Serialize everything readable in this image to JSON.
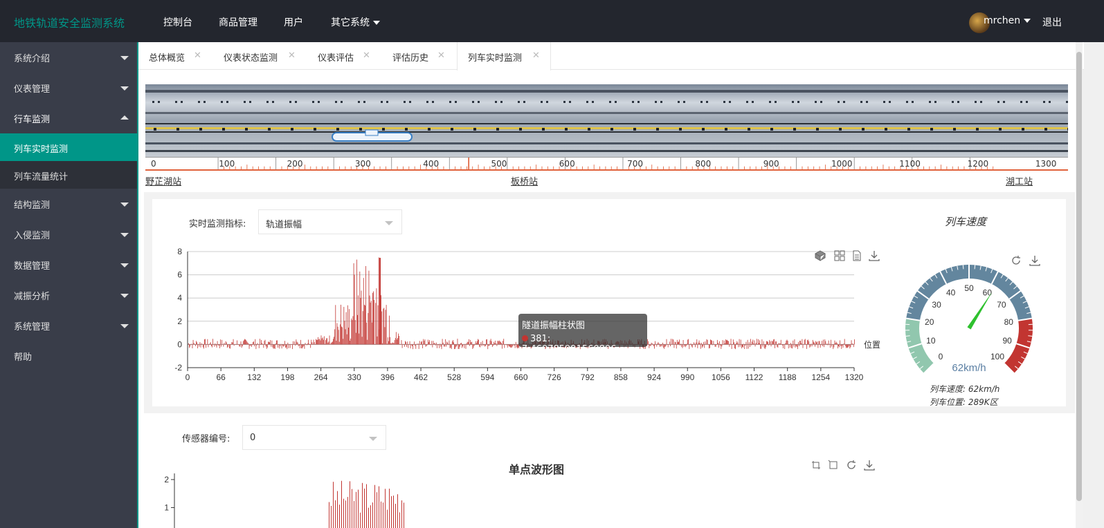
{
  "app": {
    "title": "地铁轨道安全监测系统"
  },
  "topnav": {
    "items": [
      "控制台",
      "商品管理",
      "用户",
      "其它系统"
    ],
    "user": "mrchen",
    "logout": "退出"
  },
  "sidebar": {
    "items": [
      {
        "label": "系统介绍"
      },
      {
        "label": "仪表管理"
      },
      {
        "label": "行车监测"
      },
      {
        "label": "结构监测"
      },
      {
        "label": "入侵监测"
      },
      {
        "label": "数据管理"
      },
      {
        "label": "减振分析"
      },
      {
        "label": "系统管理"
      },
      {
        "label": "帮助"
      }
    ],
    "sub": [
      "列车实时监测",
      "列车流量统计"
    ]
  },
  "tabs": [
    "总体概览",
    "仪表状态监测",
    "仪表评估",
    "评估历史",
    "列车实时监测"
  ],
  "track": {
    "ruler_labels": [
      "0",
      "100",
      "200",
      "300",
      "400",
      "500",
      "600",
      "700",
      "800",
      "900",
      "1000",
      "1100",
      "1200",
      "1300"
    ],
    "stations": [
      "野芷湖站",
      "板桥站",
      "湖工站"
    ]
  },
  "monitor": {
    "indicator_label": "实时监测指标:",
    "indicator_value": "轨道振幅",
    "x_axis_name": "位置",
    "tooltip": {
      "title": "隧道振幅柱状图",
      "value": "381: 7.460785991560806"
    }
  },
  "gauge": {
    "title": "列车速度",
    "value": 62,
    "unit_text": "62km/h",
    "ticks": [
      "0",
      "10",
      "20",
      "30",
      "40",
      "50",
      "60",
      "70",
      "80",
      "90",
      "100"
    ],
    "speed_text": "列车速度: 62km/h",
    "position_text": "列车位置: 289K区"
  },
  "sensor": {
    "label": "传感器编号:",
    "value": "0",
    "chart_title": "单点波形图"
  },
  "chart_data": [
    {
      "type": "bar",
      "title": "隧道振幅柱状图",
      "xlabel": "位置",
      "ylim": [
        -2,
        8
      ],
      "yticks": [
        -2,
        0,
        2,
        4,
        6,
        8
      ],
      "xticks": [
        0,
        66,
        132,
        198,
        264,
        330,
        396,
        462,
        528,
        594,
        660,
        726,
        792,
        858,
        924,
        990,
        1056,
        1122,
        1188,
        1254,
        1320
      ],
      "series": [
        {
          "name": "隧道振幅柱状图",
          "color": "#c23531",
          "values_summary": "baseline noise about ±0.5 across 0–1320; burst 290–420 peaking near 381 at 7.46"
        }
      ],
      "highlight": {
        "x": 381,
        "y": 7.460785991560806
      }
    },
    {
      "type": "bar",
      "title": "单点波形图",
      "ylim": [
        0,
        2
      ],
      "yticks": [
        1,
        2
      ],
      "series": [
        {
          "color": "#c23531",
          "values_summary": "bars up to 2 within burst region"
        }
      ]
    }
  ]
}
